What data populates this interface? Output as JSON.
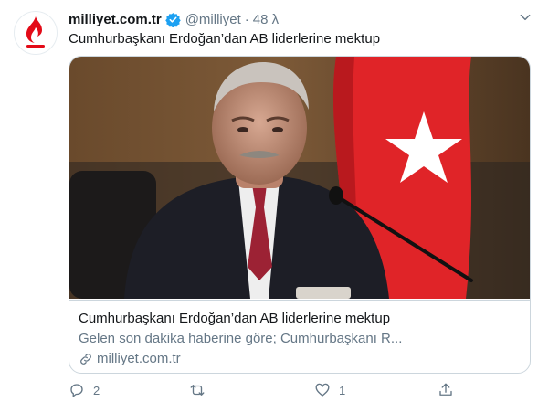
{
  "account": {
    "name": "milliyet.com.tr",
    "handle": "@milliyet",
    "separator": "·",
    "time": "48 λ",
    "avatar_icon": "milliyet-flame-logo",
    "verified_icon": "verified-badge-icon"
  },
  "tweet": {
    "text": "Cumhurbaşkanı Erdoğan’dan AB liderlerine mektup"
  },
  "card": {
    "title": "Cumhurbaşkanı Erdoğan’dan AB liderlerine mektup",
    "description": "Gelen son dakika haberine göre; Cumhurbaşkanı R...",
    "domain": "milliyet.com.tr",
    "image_alt_icon": "news-photo"
  },
  "actions": {
    "reply_count": "2",
    "retweet_count": "",
    "like_count": "1"
  },
  "colors": {
    "brand_red": "#e30a17",
    "text_primary": "#14171a",
    "text_secondary": "#657786",
    "border": "#ccd6dd",
    "verified_blue": "#1da1f2"
  }
}
